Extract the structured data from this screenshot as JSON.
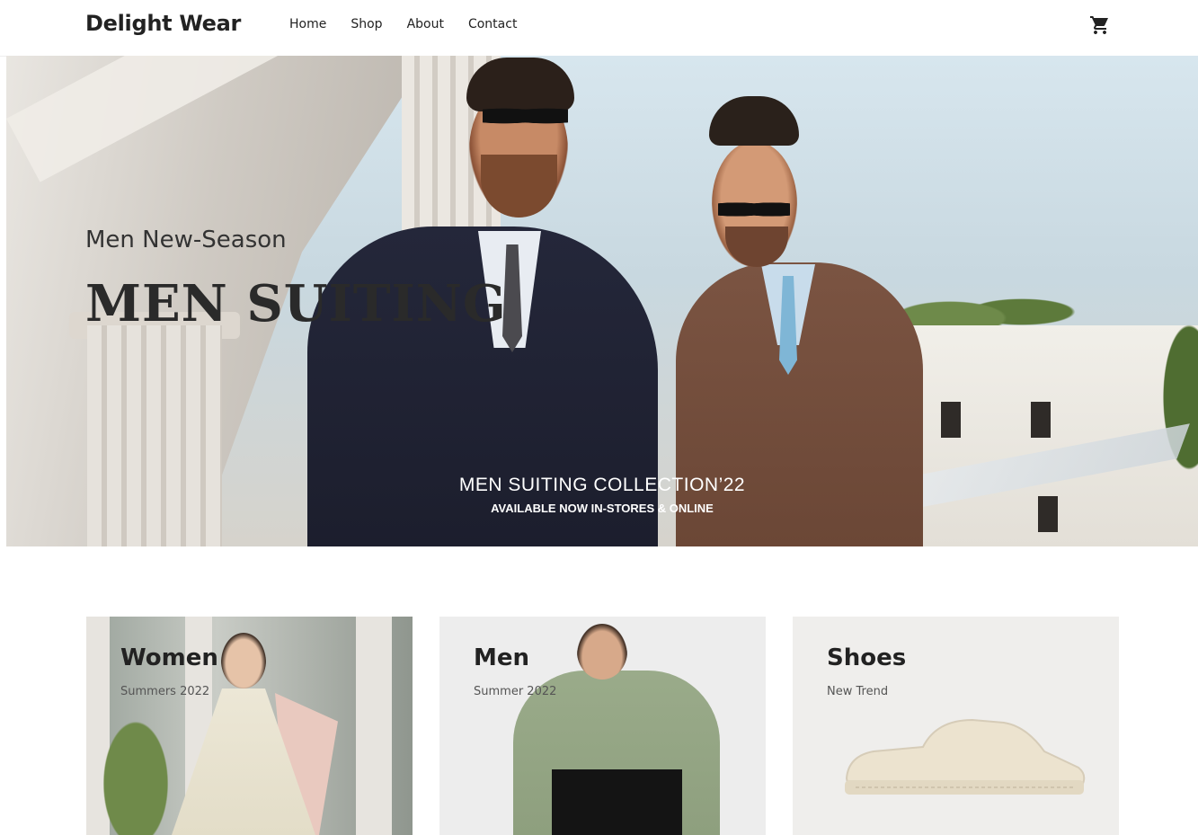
{
  "header": {
    "brand": "Delight Wear",
    "nav": [
      "Home",
      "Shop",
      "About",
      "Contact"
    ],
    "cart_icon": "cart-icon"
  },
  "hero": {
    "subtitle": "Men New-Season",
    "title": "MEN SUITING",
    "tagline": "MEN SUITING COLLECTION’22",
    "tagline_sub": "AVAILABLE NOW IN-STORES & ONLINE"
  },
  "categories": [
    {
      "title": "Women",
      "subtitle": "Summers 2022"
    },
    {
      "title": "Men",
      "subtitle": "Summer 2022"
    },
    {
      "title": "Shoes",
      "subtitle": "New Trend"
    }
  ]
}
